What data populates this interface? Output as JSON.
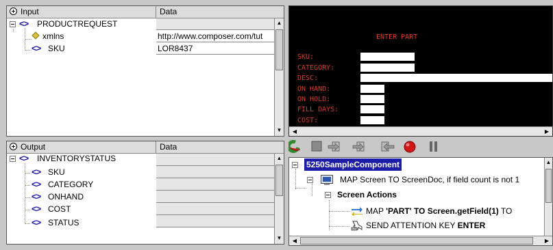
{
  "input_panel": {
    "header": {
      "col_name": "Input",
      "col_data": "Data"
    },
    "rows": [
      {
        "name": "PRODUCTREQUEST",
        "value": ""
      },
      {
        "name": "xmlns",
        "value": "http://www.composer.com/tut"
      },
      {
        "name": "SKU",
        "value": "LOR8437"
      }
    ]
  },
  "output_panel": {
    "header": {
      "col_name": "Output",
      "col_data": "Data"
    },
    "rows": [
      {
        "name": "INVENTORYSTATUS"
      },
      {
        "name": "SKU"
      },
      {
        "name": "CATEGORY"
      },
      {
        "name": "ONHAND"
      },
      {
        "name": "COST"
      },
      {
        "name": "STATUS"
      }
    ]
  },
  "terminal": {
    "title": "ENTER PART",
    "fields": [
      "SKU:",
      "CATEGORY:",
      "DESC:",
      "ON HAND:",
      "ON HOLD:",
      "FILL DAYS:",
      "COST:"
    ]
  },
  "toolbar": {
    "icons": [
      "run-icon",
      "stop-icon",
      "step-into-icon",
      "step-over-icon",
      "step-out-icon",
      "breakpoint-icon",
      "pause-icon"
    ]
  },
  "action_tree": {
    "component": "5250SampleComponent",
    "map_screen": "MAP Screen TO ScreenDoc, if field count is not 1",
    "screen_actions": "Screen Actions",
    "map_part_prefix": "MAP ",
    "map_part_bold": "'PART' TO Screen.getField(1)",
    "map_part_suffix": " TO",
    "send_key_prefix": "SEND ATTENTION KEY ",
    "send_key_bold": "ENTER"
  },
  "colors": {
    "terminal_bg": "#000000",
    "terminal_text": "#e23a2a",
    "tag_blue": "#1a1aa8",
    "selection": "#1c1ca8"
  }
}
